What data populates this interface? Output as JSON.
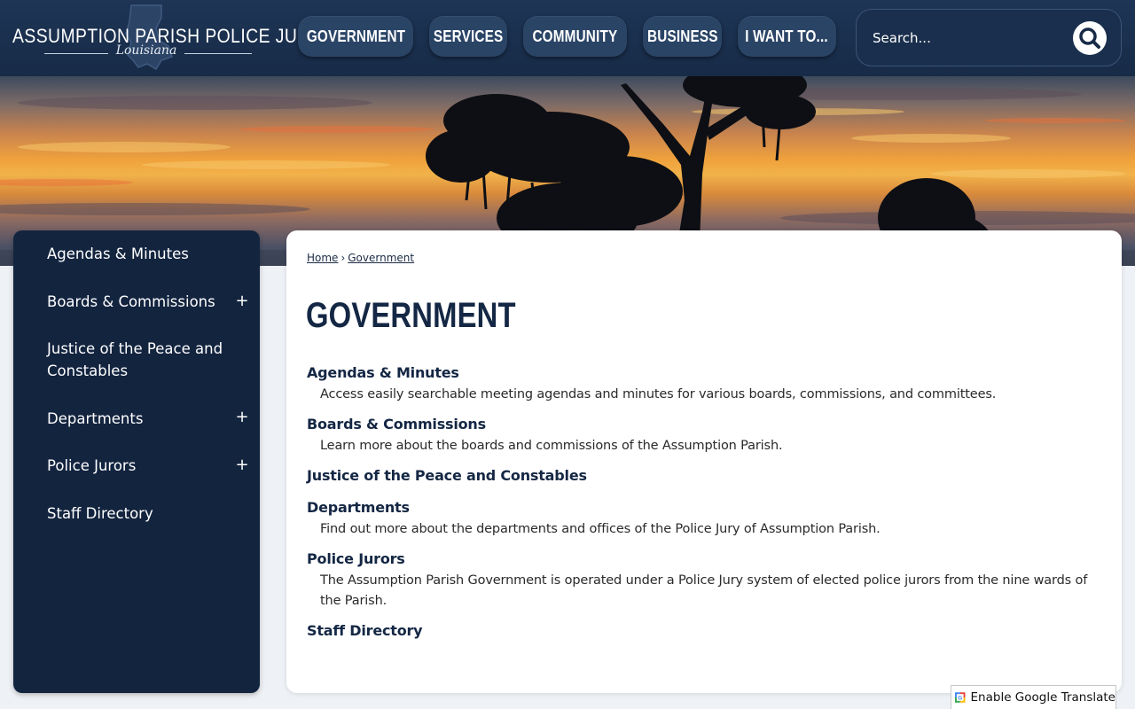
{
  "site": {
    "logo_title": "Assumption Parish Police Jury",
    "logo_subtitle": "Louisiana"
  },
  "nav": {
    "items": [
      {
        "label": "GOVERNMENT"
      },
      {
        "label": "SERVICES"
      },
      {
        "label": "COMMUNITY"
      },
      {
        "label": "BUSINESS"
      },
      {
        "label": "I WANT TO..."
      }
    ]
  },
  "search": {
    "placeholder": "Search...",
    "icon": "search-icon"
  },
  "banner": {
    "description": "sunset-with-oak-trees"
  },
  "sidebar": {
    "items": [
      {
        "label": "Agendas & Minutes",
        "expandable": false
      },
      {
        "label": "Boards & Commissions",
        "expandable": true,
        "toggle": "+"
      },
      {
        "label": "Justice of the Peace and Constables",
        "expandable": false
      },
      {
        "label": "Departments",
        "expandable": true,
        "toggle": "+"
      },
      {
        "label": "Police Jurors",
        "expandable": true,
        "toggle": "+"
      },
      {
        "label": "Staff Directory",
        "expandable": false
      }
    ]
  },
  "breadcrumb": {
    "items": [
      {
        "label": "Home"
      },
      {
        "label": "Government"
      }
    ],
    "separator": "›"
  },
  "main": {
    "page_title": "GOVERNMENT",
    "entries": [
      {
        "title": "Agendas & Minutes",
        "description": "Access easily searchable meeting agendas and minutes for various boards, commissions, and committees."
      },
      {
        "title": "Boards & Commissions",
        "description": "Learn more about the boards and commissions of the Assumption Parish."
      },
      {
        "title": "Justice of the Peace and Constables",
        "description": ""
      },
      {
        "title": "Departments",
        "description": "Find out more about the departments and offices of the Police Jury of Assumption Parish."
      },
      {
        "title": "Police Jurors",
        "description": "The Assumption Parish Government is operated under a Police Jury system of elected police jurors from the nine wards of the Parish."
      },
      {
        "title": "Staff Directory",
        "description": ""
      }
    ]
  },
  "translate": {
    "label": "Enable Google Translate"
  },
  "colors": {
    "header_bg": "#1e3556",
    "nav_button_bg": "#2a4466",
    "sidebar_bg": "#13243f",
    "title_text": "#142744",
    "page_bg": "#eef1f5"
  }
}
